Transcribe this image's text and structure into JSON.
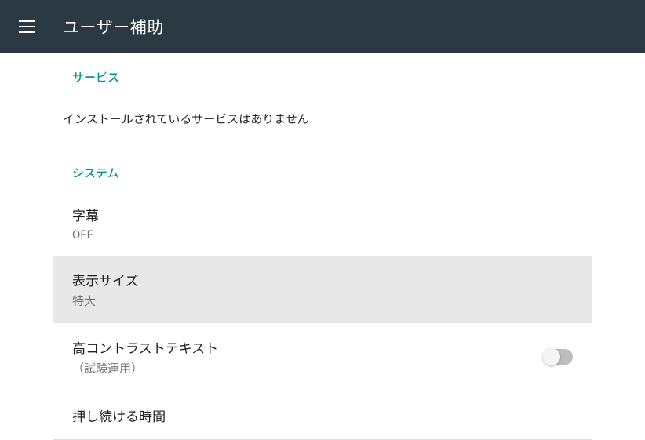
{
  "appBar": {
    "title": "ユーザー補助"
  },
  "sections": {
    "services": {
      "header": "サービス",
      "emptyMessage": "インストールされているサービスはありません"
    },
    "system": {
      "header": "システム",
      "items": {
        "captions": {
          "title": "字幕",
          "subtitle": "OFF"
        },
        "displaySize": {
          "title": "表示サイズ",
          "subtitle": "特大"
        },
        "highContrast": {
          "title": "高コントラストテキスト",
          "subtitle": "（試験運用）",
          "toggleState": false
        },
        "longPress": {
          "title": "押し続ける時間"
        }
      }
    }
  }
}
